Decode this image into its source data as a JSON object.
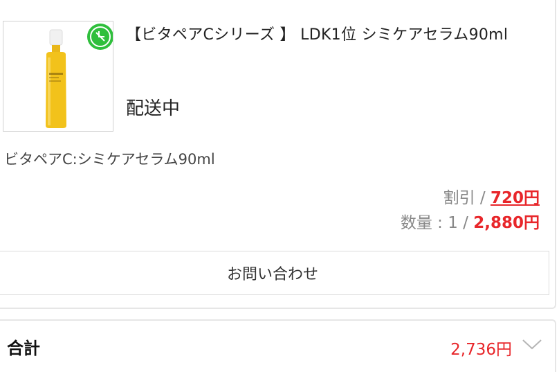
{
  "product": {
    "title": "【ビタペアCシリーズ 】 LDK1位 シミケアセラム90ml",
    "status": "配送中",
    "variant": "ビタペアC:シミケアセラム90ml",
    "image_icon": "serum-bottle-icon",
    "badge_icon": "green-badge-icon"
  },
  "pricing": {
    "discount_label": "割引 / ",
    "discount_value": "720円",
    "quantity_label": "数量 : 1 / ",
    "quantity_value": "2,880円"
  },
  "inquiry_button": {
    "label": "お問い合わせ"
  },
  "total": {
    "label": "合計",
    "value": "2,736円",
    "toggle_icon": "chevron-down-icon"
  },
  "colors": {
    "price_red": "#e8262a",
    "muted_gray": "#888888",
    "border": "#e6e6e6",
    "badge_green": "#2fbf3c",
    "serum_yellow": "#f2c21b"
  }
}
